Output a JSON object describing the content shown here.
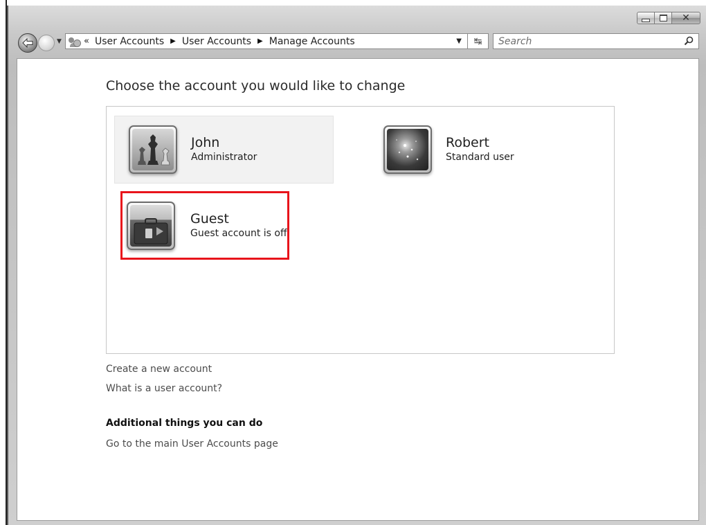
{
  "window": {
    "caption_buttons": [
      "minimize",
      "maximize",
      "close"
    ]
  },
  "nav": {
    "back_icon": "back-arrow-icon",
    "forward_icon": "forward-arrow-icon"
  },
  "address": {
    "overflow": "«",
    "crumbs": [
      "User Accounts",
      "User Accounts",
      "Manage Accounts"
    ],
    "refresh_glyph": "↹"
  },
  "search": {
    "placeholder": "Search"
  },
  "main": {
    "title": "Choose the account you would like to change",
    "accounts": [
      {
        "name": "John",
        "role": "Administrator",
        "picture": "chess-pieces"
      },
      {
        "name": "Robert",
        "role": "Standard user",
        "picture": "sparkles"
      },
      {
        "name": "Guest",
        "role": "Guest account is off",
        "picture": "suitcase"
      }
    ],
    "links": {
      "create": "Create a new account",
      "what": "What is a user account?"
    },
    "additional": {
      "heading": "Additional things you can do",
      "main_page": "Go to the main User Accounts page"
    }
  },
  "colors": {
    "highlight": "#e8141b"
  }
}
